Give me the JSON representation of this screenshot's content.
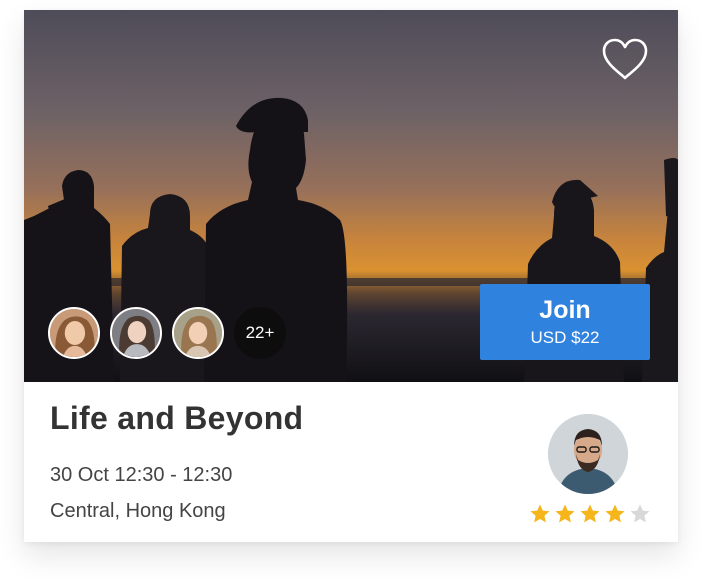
{
  "event": {
    "title": "Life and Beyond",
    "datetime": "30 Oct 12:30 - 12:30",
    "location": "Central, Hong Kong"
  },
  "join": {
    "label": "Join",
    "price": "USD $22"
  },
  "attendees": {
    "more_count": "22+"
  },
  "host": {
    "rating": 4,
    "rating_max": 5
  },
  "colors": {
    "accent": "#2f82de",
    "star_filled": "#f5b51b",
    "star_empty": "#d8d8d8",
    "title_text": "#333333"
  },
  "icons": {
    "favorite": "heart-outline-icon",
    "rating": "star-icon"
  }
}
